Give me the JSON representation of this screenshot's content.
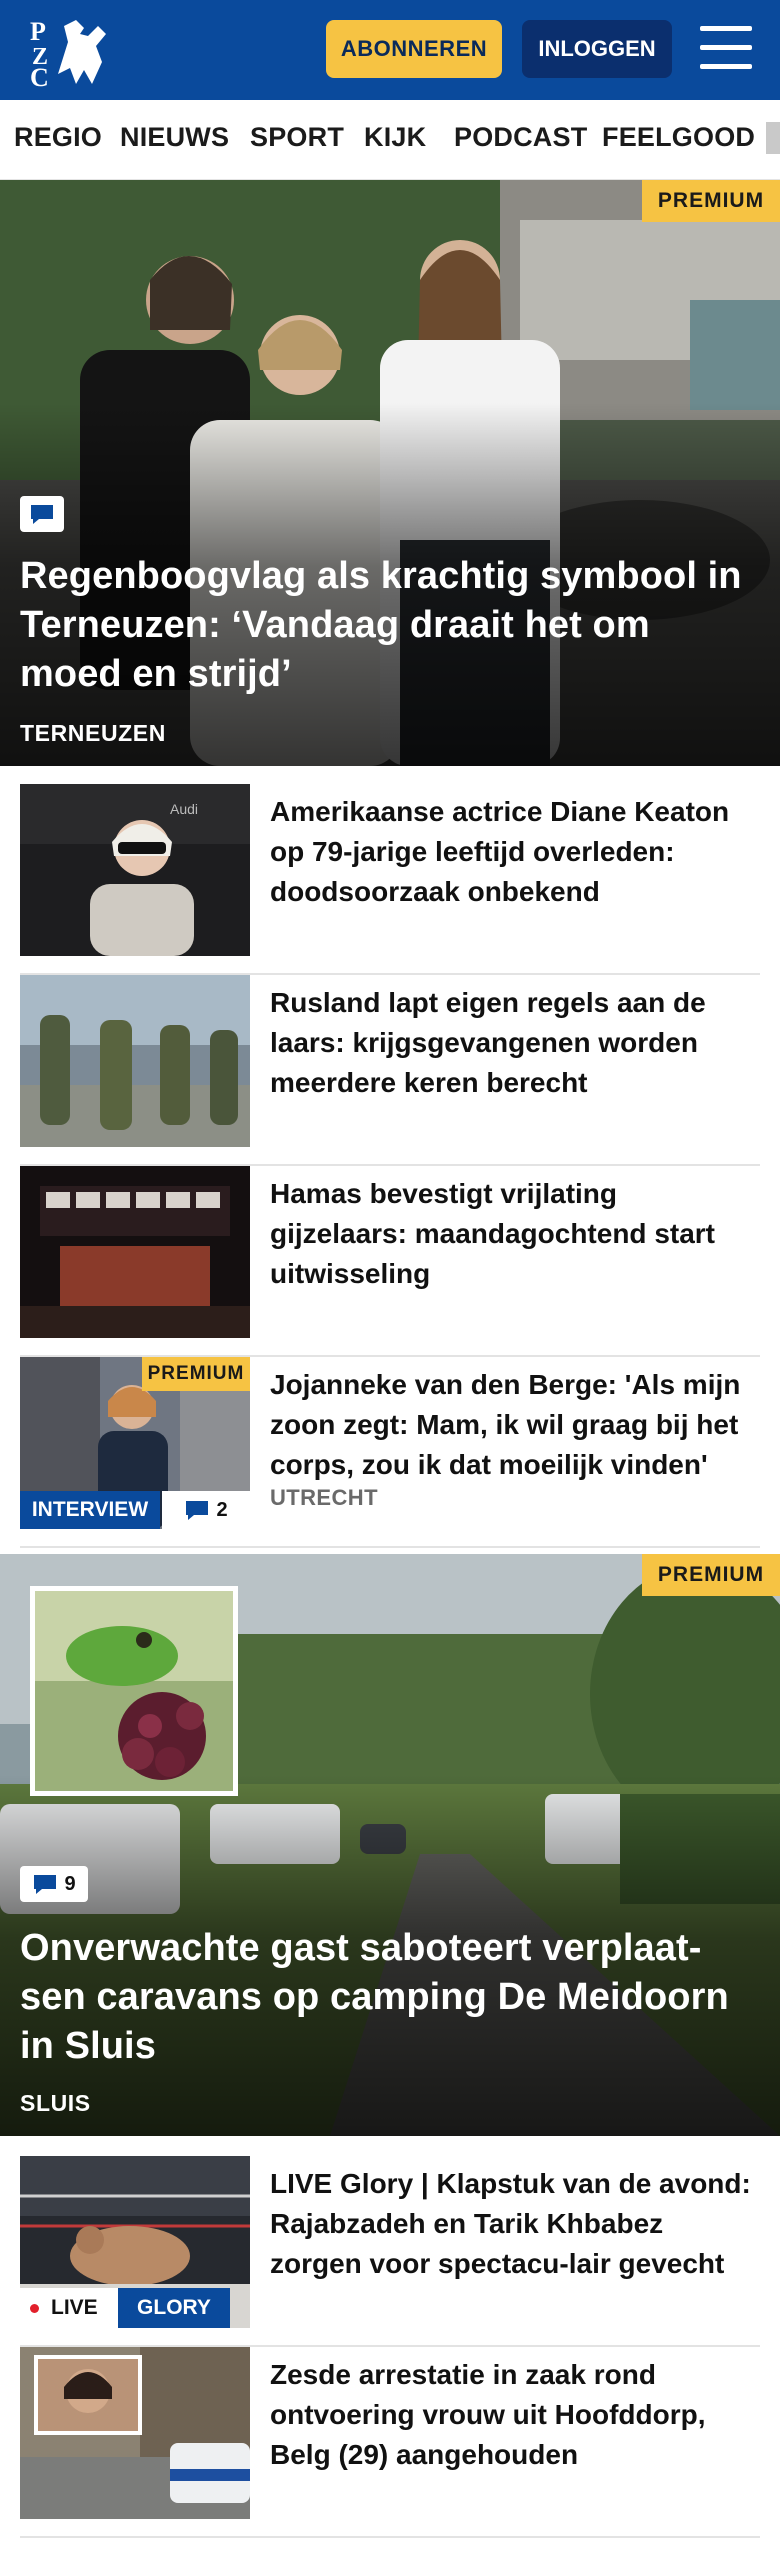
{
  "header": {
    "logo_alt": "PZC",
    "subscribe_label": "ABONNEREN",
    "login_label": "INLOGGEN",
    "menu_icon": "hamburger-icon"
  },
  "nav": {
    "items": [
      "REGIO",
      "NIEUWS",
      "SPORT",
      "KIJK",
      "PODCAST",
      "FEELGOOD"
    ]
  },
  "colors": {
    "brand_blue": "#0a4a9c",
    "accent_yellow": "#f6c343",
    "live_red": "#e2202b"
  },
  "hero1": {
    "premium": "PREMIUM",
    "comment_icon": "comment-icon",
    "title": "Regenboogvlag als krachtig symbool in Terneuzen: ‘Vandaag draait het om moed en strijd’",
    "location": "TERNEUZEN"
  },
  "list1": [
    {
      "title": "Amerikaanse actrice Diane Keaton op 79-jarige leeftijd overleden: doodsoorzaak onbekend"
    },
    {
      "title": "Rusland lapt eigen regels aan de laars: krijgsgevangenen worden meerdere keren berecht"
    },
    {
      "title": "Hamas bevestigt vrijlating gijzelaars: maandagochtend start uitwisseling"
    },
    {
      "title": "Jojanneke van den Berge: 'Als mijn zoon zegt: Mam, ik wil graag bij het corps, zou ik dat moeilijk vinden'",
      "location": "UTRECHT",
      "premium": "PREMIUM",
      "tag": "INTERVIEW",
      "comments": "2"
    }
  ],
  "hero2": {
    "premium": "PREMIUM",
    "comments": "9",
    "title": "Onverwachte gast saboteert verplaat-sen caravans op camping De Meidoorn in Sluis",
    "location": "SLUIS"
  },
  "list2": [
    {
      "title": "LIVE Glory | Klapstuk van de avond: Rajabzadeh en Tarik Khbabez zorgen voor spectacu-lair gevecht",
      "live": "LIVE",
      "tag": "GLORY"
    },
    {
      "title": "Zesde arrestatie in zaak rond ontvoering vrouw uit Hoofddorp, Belg (29) aangehouden"
    }
  ]
}
